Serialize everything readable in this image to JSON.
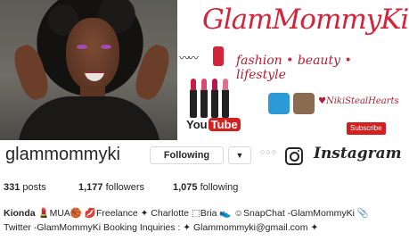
{
  "banner": {
    "title": "GlamMommyKi",
    "tagline_parts": [
      "fashion",
      "beauty",
      "lifestyle"
    ],
    "tagline_separator": "•",
    "handle": "♥NikiStealHearts",
    "youtube_text": "You",
    "youtube_tube": "Tube",
    "subscribe_label": "Subscribe"
  },
  "profile": {
    "username": "glammommyki",
    "follow_label": "Following",
    "caret": "▼",
    "more": "○○○",
    "brand_word": "Instagram",
    "stats": {
      "posts_count": "331",
      "posts_label": "posts",
      "followers_count": "1,177",
      "followers_label": "followers",
      "following_count": "1,075",
      "following_label": "following"
    },
    "bio": {
      "name": "Kionda",
      "line1": "💄MUA🏀 💋Freelance ✦ Charlotte ⬚Bria 👟 ☺SnapChat -GlamMommyKi 📎",
      "line2": "Twitter -GlamMommyKi Booking Inquiries : ✦ Glammommyki@gmail.com ✦"
    }
  },
  "colors": {
    "brand_red": "#d2243a",
    "youtube_red": "#d21f1f",
    "text": "#262626",
    "border": "#dbdbdb"
  }
}
